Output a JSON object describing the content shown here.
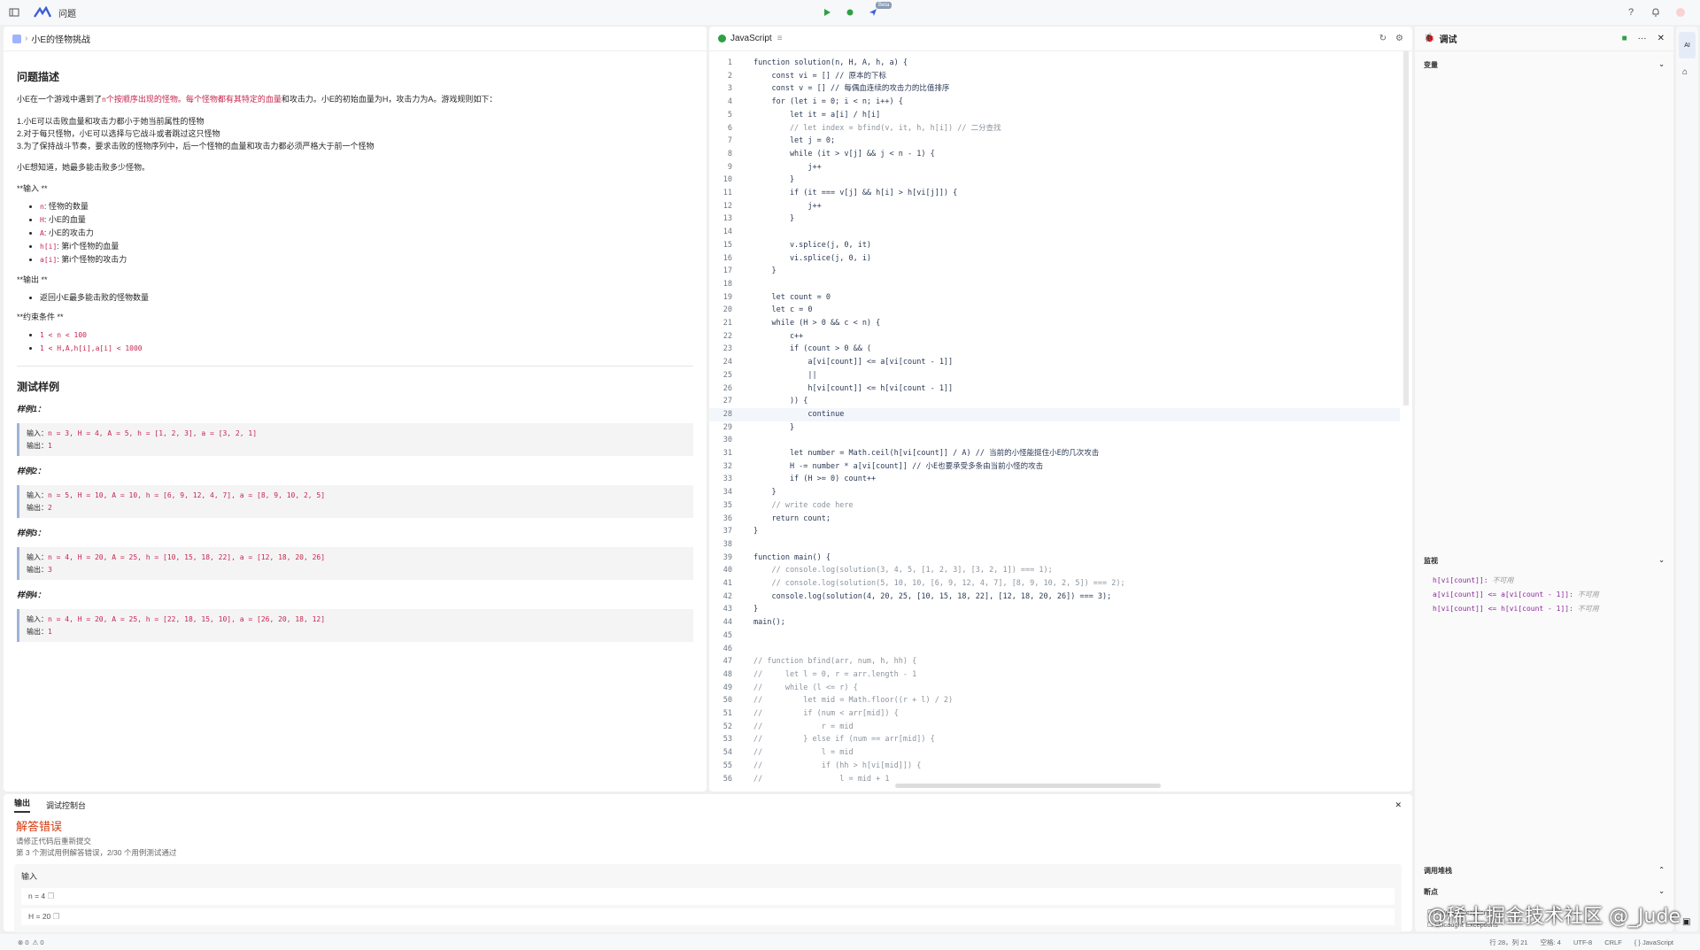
{
  "topbar": {
    "crumb": "问题",
    "beta": "Beta"
  },
  "left": {
    "tab_title": "小E的怪物挑战",
    "heading": "问题描述",
    "intro_pre": "小E在一个游戏中遇到了",
    "intro_n": "n",
    "intro_mid": "个按顺序出现的怪物。每个怪物都有其特定的血量",
    "intro_rest": "和攻击力。小E的初始血量为H，攻击力为A。游戏规则如下：",
    "rule1": "1.小E可以击败血量和攻击力都小于她当前属性的怪物",
    "rule2": "2.对于每只怪物，小E可以选择与它战斗或者跳过这只怪物",
    "rule3": "3.为了保持战斗节奏，要求击败的怪物序列中，后一个怪物的血量和攻击力都必须严格大于前一个怪物",
    "question": "小E想知道，她最多能击败多少怪物。",
    "input_title": "**输入 **",
    "inputs": [
      {
        "code": "n",
        "text": ": 怪物的数量"
      },
      {
        "code": "H",
        "text": ": 小E的血量"
      },
      {
        "code": "A",
        "text": ": 小E的攻击力"
      },
      {
        "code": "h[i]",
        "text": ": 第i个怪物的血量"
      },
      {
        "code": "a[i]",
        "text": ": 第i个怪物的攻击力"
      }
    ],
    "output_title": "**输出 **",
    "outputs": [
      "返回小E最多能击败的怪物数量"
    ],
    "constraint_title": "**约束条件 **",
    "constraints": [
      "1 < n < 100",
      "1 < H,A,h[i],a[i] < 1000"
    ],
    "samples_heading": "测试样例",
    "samples": [
      {
        "title": "样例1：",
        "input": "n = 3, H = 4, A = 5, h = [1, 2, 3], a = [3, 2, 1]",
        "output": "1"
      },
      {
        "title": "样例2：",
        "input": "n = 5, H = 10, A = 10, h = [6, 9, 12, 4, 7], a = [8, 9, 10, 2, 5]",
        "output": "2"
      },
      {
        "title": "样例3：",
        "input": "n = 4, H = 20, A = 25, h = [10, 15, 18, 22], a = [12, 18, 20, 26]",
        "output": "3"
      },
      {
        "title": "样例4：",
        "input": "n = 4, H = 20, A = 25, h = [22, 18, 15, 10], a = [26, 20, 18, 12]",
        "output": "1"
      }
    ],
    "input_label": "输入：",
    "output_label": "输出："
  },
  "editor": {
    "language": "JavaScript",
    "active_line": 28,
    "lines": [
      "function solution(n, H, A, h, a) {",
      "    const vi = [] // 原本的下标",
      "    const v = [] // 每偶血连续的攻击力的比值排序",
      "    for (let i = 0; i < n; i++) {",
      "        let it = a[i] / h[i]",
      "        // let index = bfind(v, it, h, h[i]) // 二分查找",
      "        let j = 0;",
      "        while (it > v[j] && j < n - 1) {",
      "            j++",
      "        }",
      "        if (it === v[j] && h[i] > h[vi[j]]) {",
      "            j++",
      "        }",
      "",
      "        v.splice(j, 0, it)",
      "        vi.splice(j, 0, i)",
      "    }",
      "",
      "    let count = 0",
      "    let c = 0",
      "    while (H > 0 && c < n) {",
      "        c++",
      "        if (count > 0 && (",
      "            a[vi[count]] <= a[vi[count - 1]]",
      "            ||",
      "            h[vi[count]] <= h[vi[count - 1]]",
      "        )) {",
      "            continue",
      "        }",
      "",
      "        let number = Math.ceil(h[vi[count]] / A) // 当前的小怪能挺住小E的几次攻击",
      "        H -= number * a[vi[count]] // 小E也要承受多条由当前小怪的攻击",
      "        if (H >= 0) count++",
      "    }",
      "    // write code here",
      "    return count;",
      "}",
      "",
      "function main() {",
      "    // console.log(solution(3, 4, 5, [1, 2, 3], [3, 2, 1]) === 1);",
      "    // console.log(solution(5, 10, 10, [6, 9, 12, 4, 7], [8, 9, 10, 2, 5]) === 2);",
      "    console.log(solution(4, 20, 25, [10, 15, 18, 22], [12, 18, 20, 26]) === 3);",
      "}",
      "main();",
      "",
      "",
      "// function bfind(arr, num, h, hh) {",
      "//     let l = 0, r = arr.length - 1",
      "//     while (l <= r) {",
      "//         let mid = Math.floor((r + l) / 2)",
      "//         if (num < arr[mid]) {",
      "//             r = mid",
      "//         } else if (num == arr[mid]) {",
      "//             l = mid",
      "//             if (hh > h[vi[mid]]) {",
      "//                 l = mid + 1"
    ]
  },
  "debug": {
    "title": "调试",
    "variables": "变量",
    "watch": "监视",
    "watch_items": [
      {
        "expr": "h[vi[count]]",
        "val": "不可用"
      },
      {
        "expr": "a[vi[count]] <= a[vi[count - 1]]",
        "val": "不可用"
      },
      {
        "expr": "h[vi[count]] <= h[vi[count - 1]]",
        "val": "不可用"
      }
    ],
    "call_stack": "调用堆栈",
    "breakpoints": "断点",
    "bp_caught": "Caught Exceptions",
    "bp_uncaught": "Uncaught Exceptions"
  },
  "output": {
    "tab_output": "输出",
    "tab_console": "调试控制台",
    "result": "解答错误",
    "msg1": "请修正代码后重新提交",
    "msg2": "第 3 个测试用例解答错误，2/30 个用例测试通过",
    "input_label": "输入",
    "rows": [
      "n = 4",
      "H = 20"
    ]
  },
  "status": {
    "errors": "0",
    "warnings": "0",
    "position": "行 28，列 21",
    "spaces": "空格: 4",
    "encoding": "UTF-8",
    "eol": "CRLF",
    "lang": "{ } JavaScript"
  },
  "watermark": "@稀土掘金技术社区 @_Jude",
  "rail": {
    "ai": "AI"
  },
  "colors": {
    "accent": "#2f3fbf",
    "error": "#d4380d",
    "run": "#2ea043"
  }
}
